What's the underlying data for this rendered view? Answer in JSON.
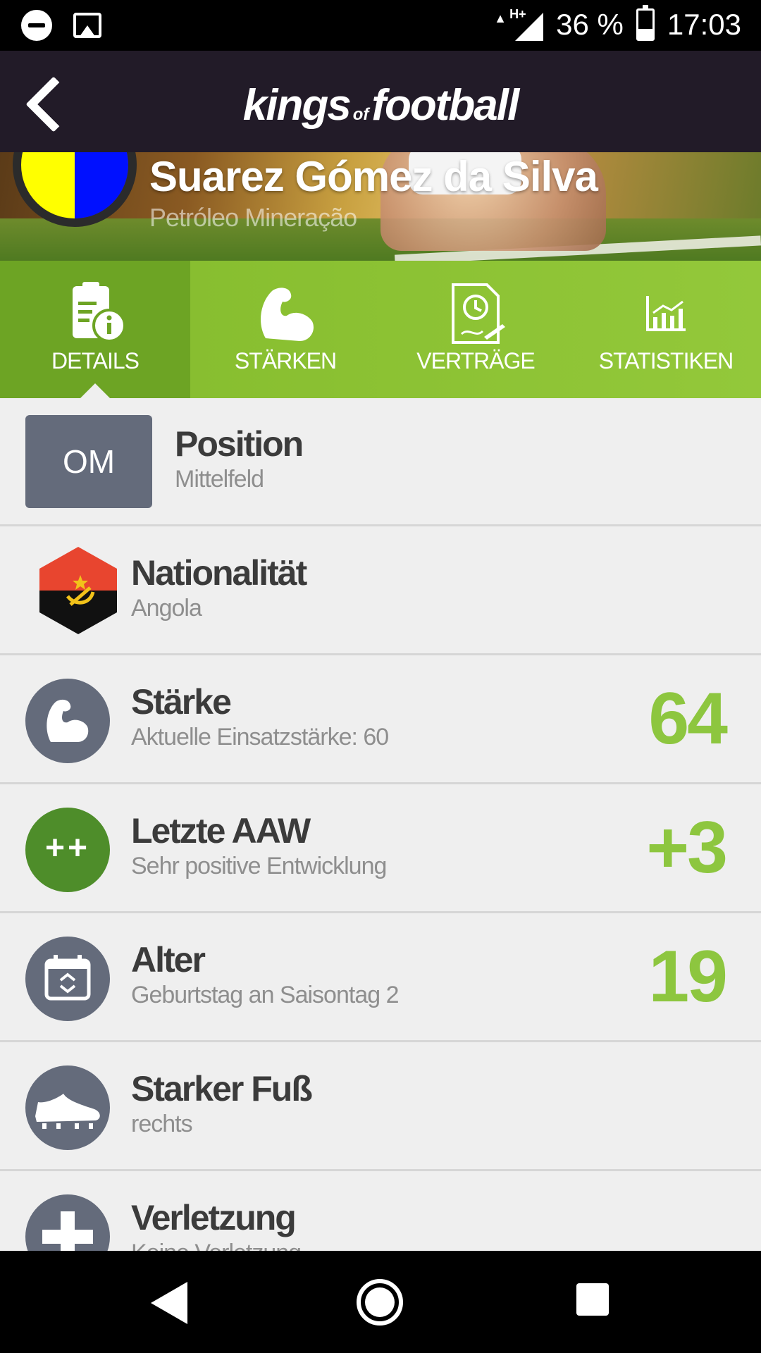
{
  "status_bar": {
    "battery": "36 %",
    "time": "17:03",
    "network": "H+"
  },
  "app_bar": {
    "brand_left": "kings",
    "brand_of": "of",
    "brand_right": "football"
  },
  "player": {
    "name": "Suarez Gómez da Silva",
    "club": "Petróleo Mineração",
    "club_colors": [
      "#ffff00",
      "#0010ff"
    ]
  },
  "tabs": [
    {
      "label": "DETAILS",
      "icon": "clipboard-info-icon",
      "active": true
    },
    {
      "label": "STÄRKEN",
      "icon": "biceps-icon",
      "active": false
    },
    {
      "label": "VERTRÄGE",
      "icon": "contract-clock-icon",
      "active": false
    },
    {
      "label": "STATISTIKEN",
      "icon": "chart-icon",
      "active": false
    }
  ],
  "details": {
    "position": {
      "badge": "OM",
      "title": "Position",
      "sub": "Mittelfeld"
    },
    "nationality": {
      "title": "Nationalität",
      "sub": "Angola",
      "flag": "angola-flag-icon"
    },
    "strength": {
      "title": "Stärke",
      "sub": "Aktuelle Einsatzstärke: 60",
      "value": "64"
    },
    "last_aaw": {
      "title": "Letzte AAW",
      "sub": "Sehr positive Entwicklung",
      "value": "+3",
      "icon_text": "++"
    },
    "age": {
      "title": "Alter",
      "sub": "Geburtstag an Saisontag 2",
      "value": "19"
    },
    "foot": {
      "title": "Starker Fuß",
      "sub": "rechts"
    },
    "injury": {
      "title": "Verletzung",
      "sub": "Keine Verletzung"
    }
  },
  "colors": {
    "accent_green": "#8dc63f",
    "tab_green": "#84bb2c",
    "appbar": "#221b28",
    "badge_gray": "#646b7b"
  }
}
